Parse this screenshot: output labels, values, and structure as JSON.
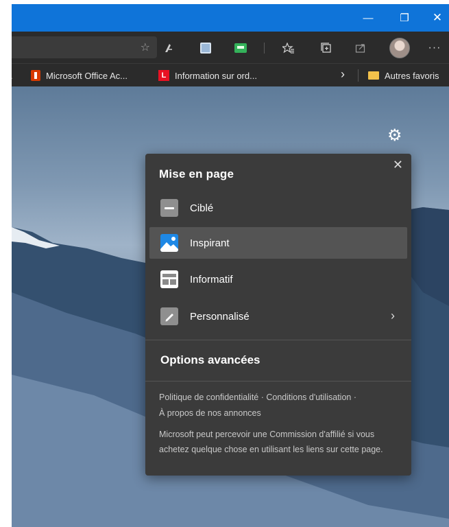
{
  "window": {
    "minimize_glyph": "—",
    "maximize_glyph": "❐",
    "close_glyph": "✕"
  },
  "toolbar": {
    "icons": [
      "star-icon",
      "reading-icon",
      "collection-extension-icon",
      "green-extension-icon",
      "favorites-icon",
      "collections-icon",
      "share-icon",
      "profile-avatar",
      "more-icon"
    ],
    "more_glyph": "···"
  },
  "favorites_bar": {
    "items": [
      {
        "label": "Microsoft Office Ac...",
        "icon": "office-icon",
        "color": "#d83b01"
      },
      {
        "label": "Information sur ord...",
        "icon": "l-icon",
        "color": "#e81123",
        "favicon_text": "L"
      }
    ],
    "overflow_glyph": "›",
    "other_favorites_label": "Autres favoris"
  },
  "panel": {
    "title": "Mise en page",
    "close_glyph": "✕",
    "options": [
      {
        "label": "Ciblé",
        "icon": "focused-layout-icon",
        "selected": false
      },
      {
        "label": "Inspirant",
        "icon": "inspirational-layout-icon",
        "selected": true
      },
      {
        "label": "Informatif",
        "icon": "informational-layout-icon",
        "selected": false
      },
      {
        "label": "Personnalisé",
        "icon": "custom-layout-icon",
        "selected": false
      }
    ],
    "chevron_glyph": "›",
    "advanced_label": "Options avancées",
    "links": {
      "privacy": "Politique de confidentialité",
      "separator": " · ",
      "terms": "Conditions d'utilisation",
      "trailing": " ·",
      "about_ads": "À propos de nos annonces"
    },
    "note": "Microsoft peut percevoir une Commission d'affilié si vous achetez quelque chose en utilisant les liens sur cette page."
  },
  "colors": {
    "titlebar": "#0f74d9",
    "toolbar": "#2b2b2b",
    "panel": "#3b3b3b",
    "selected_row": "#545454"
  }
}
